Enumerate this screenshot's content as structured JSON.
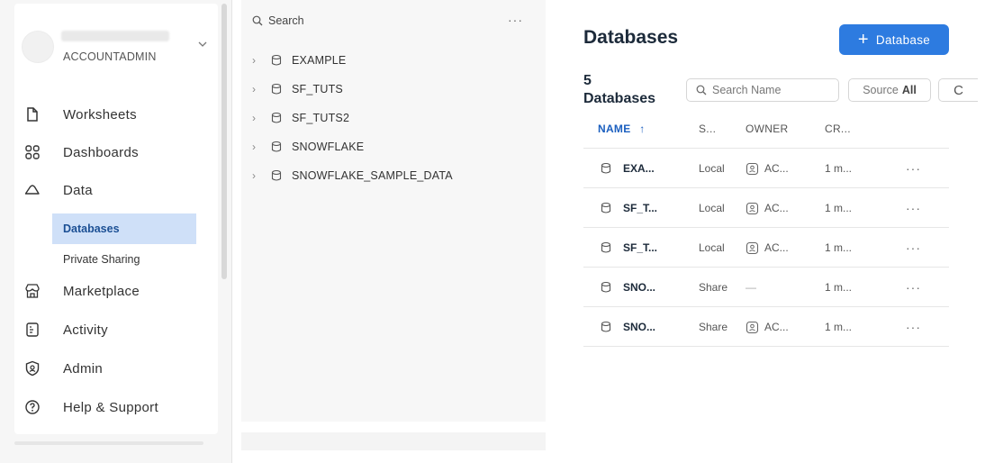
{
  "account": {
    "role": "ACCOUNTADMIN"
  },
  "nav": {
    "items": [
      {
        "label": "Worksheets",
        "icon": "file-icon"
      },
      {
        "label": "Dashboards",
        "icon": "grid-icon"
      },
      {
        "label": "Data",
        "icon": "cloud-icon"
      },
      {
        "label": "Marketplace",
        "icon": "store-icon"
      },
      {
        "label": "Activity",
        "icon": "activity-icon"
      },
      {
        "label": "Admin",
        "icon": "shield-icon"
      },
      {
        "label": "Help & Support",
        "icon": "help-icon"
      }
    ],
    "data_sub": [
      {
        "label": "Databases",
        "active": true
      },
      {
        "label": "Private Sharing",
        "active": false
      }
    ]
  },
  "tree": {
    "search_label": "Search",
    "more": "···",
    "items": [
      "EXAMPLE",
      "SF_TUTS",
      "SF_TUTS2",
      "SNOWFLAKE",
      "SNOWFLAKE_SAMPLE_DATA"
    ]
  },
  "main": {
    "title": "Databases",
    "add_button": "Database",
    "count_number": "5",
    "count_label": "Databases",
    "search_placeholder": "Search Name",
    "source_label": "Source",
    "source_value": "All",
    "refresh": "C",
    "columns": {
      "name": "NAME",
      "sort_arrow": "↑",
      "source": "S...",
      "owner": "OWNER",
      "created": "CR..."
    },
    "rows": [
      {
        "name": "EXA...",
        "source": "Local",
        "owner": "AC...",
        "created": "1 m...",
        "more": "···"
      },
      {
        "name": "SF_T...",
        "source": "Local",
        "owner": "AC...",
        "created": "1 m...",
        "more": "···"
      },
      {
        "name": "SF_T...",
        "source": "Local",
        "owner": "AC...",
        "created": "1 m...",
        "more": "···"
      },
      {
        "name": "SNO...",
        "source": "Share",
        "owner": "—",
        "created": "1 m...",
        "more": "···"
      },
      {
        "name": "SNO...",
        "source": "Share",
        "owner": "AC...",
        "created": "1 m...",
        "more": "···"
      }
    ]
  },
  "colors": {
    "accent": "#2d7be0",
    "active_bg": "#cfe0f8",
    "active_text": "#1b4f94"
  }
}
